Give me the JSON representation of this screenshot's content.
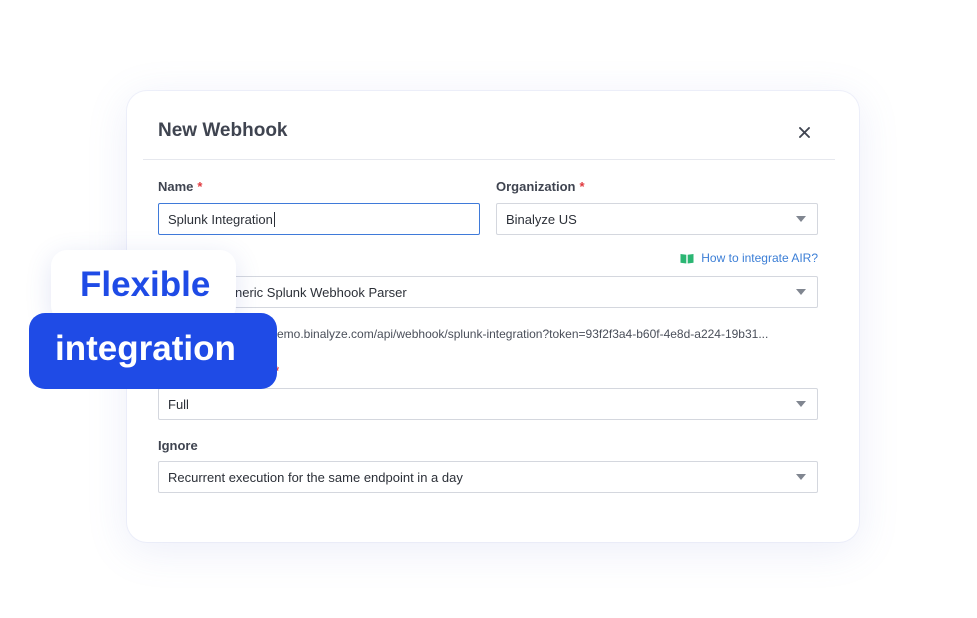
{
  "dialog": {
    "title": "New Webhook",
    "close_symbol": "×"
  },
  "form": {
    "name": {
      "label": "Name",
      "required_mark": "*",
      "value": "Splunk Integration"
    },
    "organization": {
      "label": "Organization",
      "required_mark": "*",
      "value": "Binalyze US"
    },
    "help_link": {
      "icon": "book-icon",
      "label": "How to integrate AIR?"
    },
    "parser": {
      "value_visible": "neric Splunk Webhook Parser"
    },
    "url": {
      "value_visible": "emo.binalyze.com/api/webhook/splunk-integration?token=93f2f3a4-b60f-4e8d-a224-19b31..."
    },
    "fourth_field": {
      "required_mark": "*",
      "value": "Full"
    },
    "ignore": {
      "label": "Ignore",
      "value": "Recurrent execution for the same endpoint in a day"
    }
  },
  "badges": {
    "flexible": "Flexible",
    "integration": "integration"
  },
  "colors": {
    "brand_blue": "#1f4be6",
    "link_blue": "#3b7ed6",
    "required_red": "#e0393e",
    "help_icon_green": "#2bb673",
    "focus_border": "#3f7ad9"
  }
}
